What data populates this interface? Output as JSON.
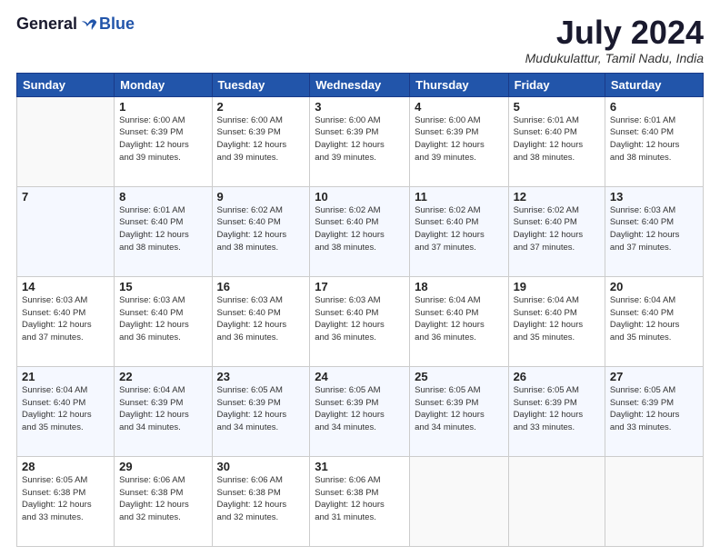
{
  "logo": {
    "general": "General",
    "blue": "Blue"
  },
  "header": {
    "month": "July 2024",
    "location": "Mudukulattur, Tamil Nadu, India"
  },
  "days_of_week": [
    "Sunday",
    "Monday",
    "Tuesday",
    "Wednesday",
    "Thursday",
    "Friday",
    "Saturday"
  ],
  "weeks": [
    [
      {
        "day": "",
        "info": ""
      },
      {
        "day": "1",
        "info": "Sunrise: 6:00 AM\nSunset: 6:39 PM\nDaylight: 12 hours\nand 39 minutes."
      },
      {
        "day": "2",
        "info": "Sunrise: 6:00 AM\nSunset: 6:39 PM\nDaylight: 12 hours\nand 39 minutes."
      },
      {
        "day": "3",
        "info": "Sunrise: 6:00 AM\nSunset: 6:39 PM\nDaylight: 12 hours\nand 39 minutes."
      },
      {
        "day": "4",
        "info": "Sunrise: 6:00 AM\nSunset: 6:39 PM\nDaylight: 12 hours\nand 39 minutes."
      },
      {
        "day": "5",
        "info": "Sunrise: 6:01 AM\nSunset: 6:40 PM\nDaylight: 12 hours\nand 38 minutes."
      },
      {
        "day": "6",
        "info": "Sunrise: 6:01 AM\nSunset: 6:40 PM\nDaylight: 12 hours\nand 38 minutes."
      }
    ],
    [
      {
        "day": "7",
        "info": ""
      },
      {
        "day": "8",
        "info": "Sunrise: 6:01 AM\nSunset: 6:40 PM\nDaylight: 12 hours\nand 38 minutes."
      },
      {
        "day": "9",
        "info": "Sunrise: 6:02 AM\nSunset: 6:40 PM\nDaylight: 12 hours\nand 38 minutes."
      },
      {
        "day": "10",
        "info": "Sunrise: 6:02 AM\nSunset: 6:40 PM\nDaylight: 12 hours\nand 38 minutes."
      },
      {
        "day": "11",
        "info": "Sunrise: 6:02 AM\nSunset: 6:40 PM\nDaylight: 12 hours\nand 37 minutes."
      },
      {
        "day": "12",
        "info": "Sunrise: 6:02 AM\nSunset: 6:40 PM\nDaylight: 12 hours\nand 37 minutes."
      },
      {
        "day": "13",
        "info": "Sunrise: 6:03 AM\nSunset: 6:40 PM\nDaylight: 12 hours\nand 37 minutes."
      }
    ],
    [
      {
        "day": "14",
        "info": "Sunrise: 6:03 AM\nSunset: 6:40 PM\nDaylight: 12 hours\nand 37 minutes."
      },
      {
        "day": "15",
        "info": "Sunrise: 6:03 AM\nSunset: 6:40 PM\nDaylight: 12 hours\nand 36 minutes."
      },
      {
        "day": "16",
        "info": "Sunrise: 6:03 AM\nSunset: 6:40 PM\nDaylight: 12 hours\nand 36 minutes."
      },
      {
        "day": "17",
        "info": "Sunrise: 6:03 AM\nSunset: 6:40 PM\nDaylight: 12 hours\nand 36 minutes."
      },
      {
        "day": "18",
        "info": "Sunrise: 6:04 AM\nSunset: 6:40 PM\nDaylight: 12 hours\nand 36 minutes."
      },
      {
        "day": "19",
        "info": "Sunrise: 6:04 AM\nSunset: 6:40 PM\nDaylight: 12 hours\nand 35 minutes."
      },
      {
        "day": "20",
        "info": "Sunrise: 6:04 AM\nSunset: 6:40 PM\nDaylight: 12 hours\nand 35 minutes."
      }
    ],
    [
      {
        "day": "21",
        "info": "Sunrise: 6:04 AM\nSunset: 6:40 PM\nDaylight: 12 hours\nand 35 minutes."
      },
      {
        "day": "22",
        "info": "Sunrise: 6:04 AM\nSunset: 6:39 PM\nDaylight: 12 hours\nand 34 minutes."
      },
      {
        "day": "23",
        "info": "Sunrise: 6:05 AM\nSunset: 6:39 PM\nDaylight: 12 hours\nand 34 minutes."
      },
      {
        "day": "24",
        "info": "Sunrise: 6:05 AM\nSunset: 6:39 PM\nDaylight: 12 hours\nand 34 minutes."
      },
      {
        "day": "25",
        "info": "Sunrise: 6:05 AM\nSunset: 6:39 PM\nDaylight: 12 hours\nand 34 minutes."
      },
      {
        "day": "26",
        "info": "Sunrise: 6:05 AM\nSunset: 6:39 PM\nDaylight: 12 hours\nand 33 minutes."
      },
      {
        "day": "27",
        "info": "Sunrise: 6:05 AM\nSunset: 6:39 PM\nDaylight: 12 hours\nand 33 minutes."
      }
    ],
    [
      {
        "day": "28",
        "info": "Sunrise: 6:05 AM\nSunset: 6:38 PM\nDaylight: 12 hours\nand 33 minutes."
      },
      {
        "day": "29",
        "info": "Sunrise: 6:06 AM\nSunset: 6:38 PM\nDaylight: 12 hours\nand 32 minutes."
      },
      {
        "day": "30",
        "info": "Sunrise: 6:06 AM\nSunset: 6:38 PM\nDaylight: 12 hours\nand 32 minutes."
      },
      {
        "day": "31",
        "info": "Sunrise: 6:06 AM\nSunset: 6:38 PM\nDaylight: 12 hours\nand 31 minutes."
      },
      {
        "day": "",
        "info": ""
      },
      {
        "day": "",
        "info": ""
      },
      {
        "day": "",
        "info": ""
      }
    ]
  ]
}
